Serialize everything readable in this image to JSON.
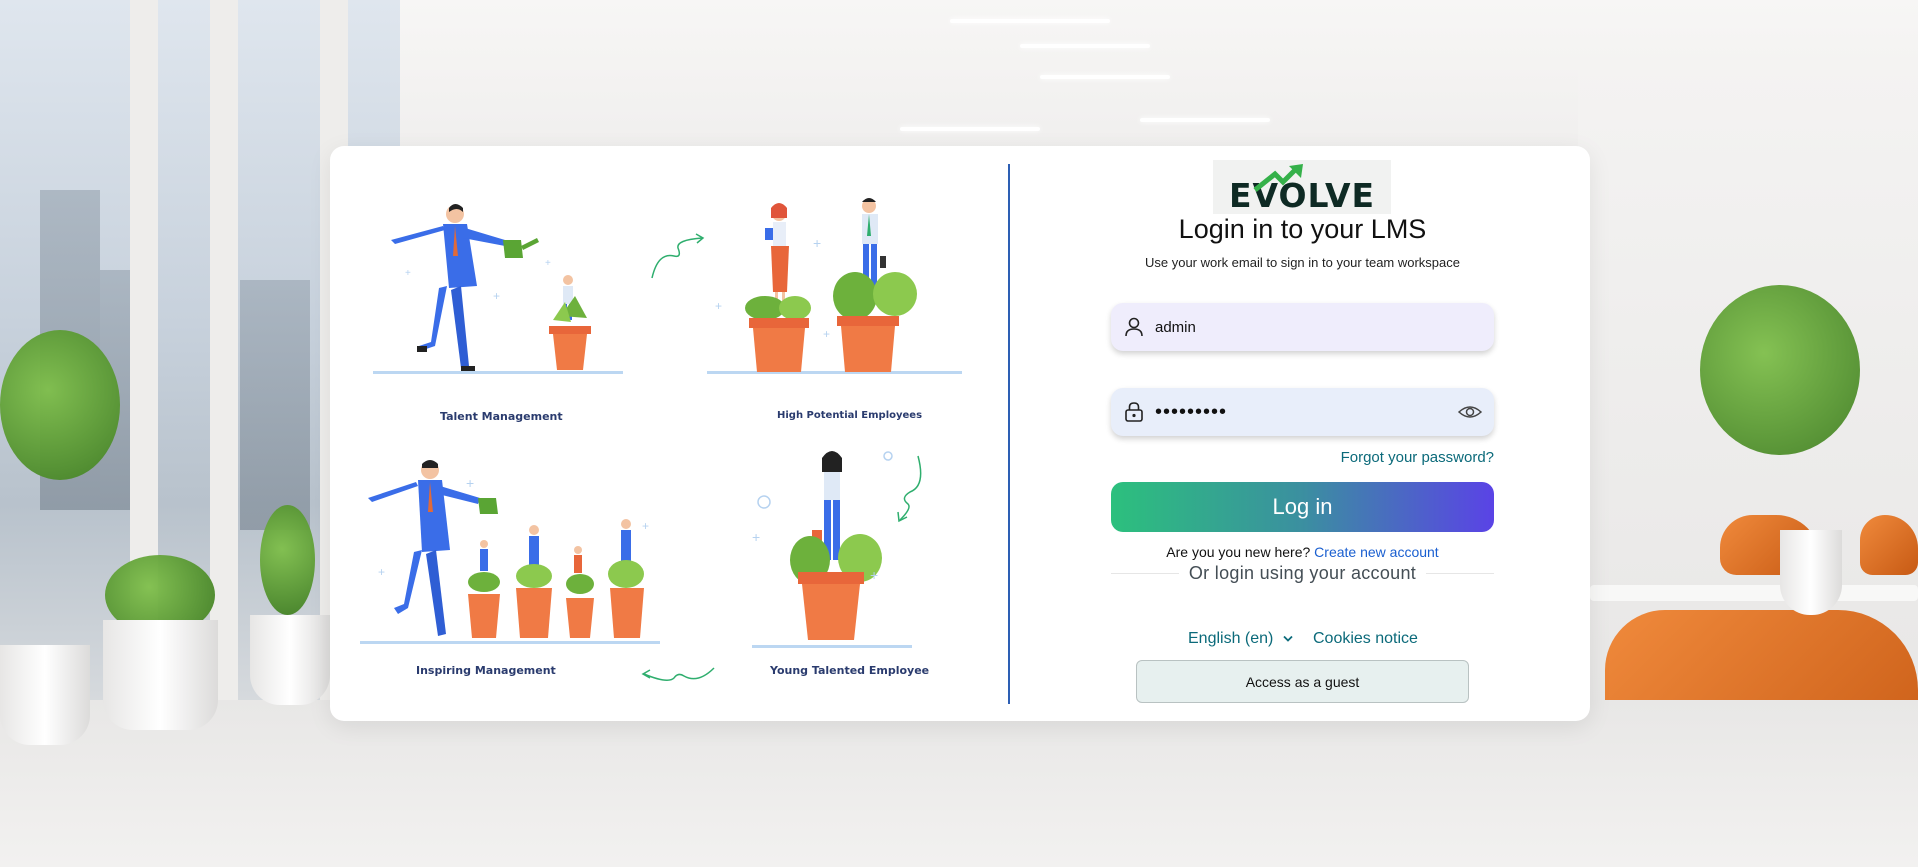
{
  "logo": {
    "text": "EVOLVE"
  },
  "login": {
    "title": "Login in to your LMS",
    "subtitle": "Use your work email to sign in to your team workspace",
    "username_value": "admin",
    "password_masked": "•••••••••",
    "forgot_label": "Forgot your password?",
    "submit_label": "Log in",
    "new_here_text": "Are you you new here?",
    "create_account_label": "Create new account",
    "or_text": "Or login using your account",
    "language_label": "English (en)",
    "cookies_label": "Cookies notice",
    "guest_label": "Access as a guest"
  },
  "illustrations": {
    "captions": [
      "Talent Management",
      "High Potential Employees",
      "Inspiring  Management",
      "Young Talented Employee"
    ]
  },
  "colors": {
    "divider": "#2d5fb4",
    "link": "#0b6a7a",
    "create_link": "#1a5fd0",
    "button_gradient_start": "#2cc07d",
    "button_gradient_end": "#5a43e6"
  }
}
